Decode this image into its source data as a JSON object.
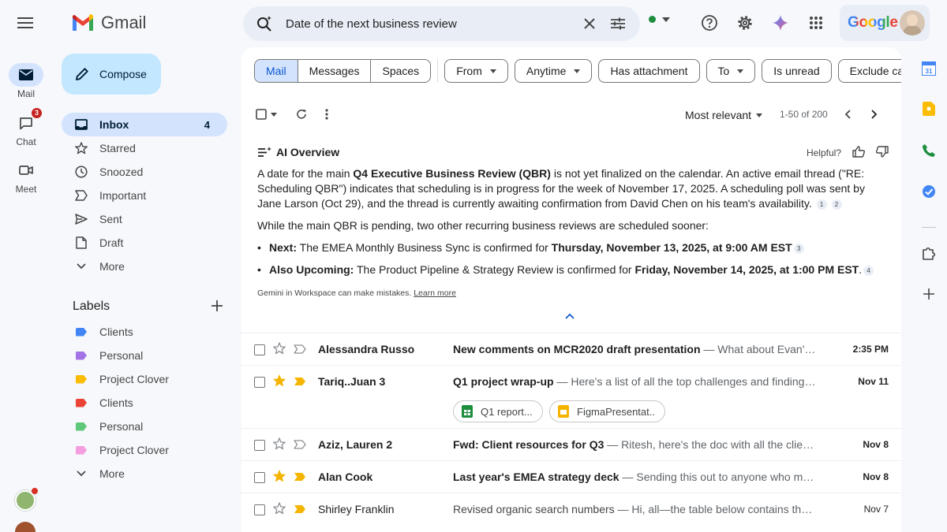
{
  "app": {
    "name": "Gmail"
  },
  "rail": {
    "items": [
      {
        "label": "Mail",
        "icon": "mail-icon",
        "active": true
      },
      {
        "label": "Chat",
        "icon": "chat-icon",
        "badge": "3"
      },
      {
        "label": "Meet",
        "icon": "video-icon"
      }
    ]
  },
  "header": {
    "search_value": "Date of the next business review",
    "brand_word": "Google"
  },
  "compose_label": "Compose",
  "nav": [
    {
      "label": "Inbox",
      "count": "4",
      "icon": "inbox-icon"
    },
    {
      "label": "Starred",
      "icon": "star-icon"
    },
    {
      "label": "Snoozed",
      "icon": "clock-icon"
    },
    {
      "label": "Important",
      "icon": "important-icon"
    },
    {
      "label": "Sent",
      "icon": "send-icon"
    },
    {
      "label": "Draft",
      "icon": "draft-icon"
    },
    {
      "label": "More",
      "icon": "chevron-down-icon"
    }
  ],
  "labels": {
    "title": "Labels",
    "items": [
      {
        "label": "Clients",
        "color": "#4285f4"
      },
      {
        "label": "Personal",
        "color": "#a374e6"
      },
      {
        "label": "Project Clover",
        "color": "#fbbc04"
      },
      {
        "label": "Clients",
        "color": "#ea4335"
      },
      {
        "label": "Personal",
        "color": "#5ec87a"
      },
      {
        "label": "Project Clover",
        "color": "#f49ee0"
      }
    ],
    "more": "More"
  },
  "filters": {
    "segments": [
      "Mail",
      "Messages",
      "Spaces"
    ],
    "chips": [
      {
        "label": "From",
        "dropdown": true
      },
      {
        "label": "Anytime",
        "dropdown": true
      },
      {
        "label": "Has attachment",
        "dropdown": false
      },
      {
        "label": "To",
        "dropdown": true
      },
      {
        "label": "Is unread",
        "dropdown": false
      },
      {
        "label": "Exclude cale",
        "dropdown": false
      }
    ]
  },
  "toolbar": {
    "sort": "Most relevant",
    "range": "1-50 of 200"
  },
  "ai_overview": {
    "title": "AI Overview",
    "helpful": "Helpful?",
    "p1_a": "A date for the main ",
    "p1_b": "Q4 Executive Business Review (QBR)",
    "p1_c": " is not yet finalized on the calendar. An active email thread (\"RE: Scheduling QBR\") indicates that scheduling is in progress for the week of November 17, 2025. A scheduling poll was sent by Jane Larson (Oct 29), and the thread is currently awaiting confirmation from David Chen on his team's availability.",
    "cite1": "1",
    "cite2": "2",
    "p2": "While the main QBR is pending, two other recurring business reviews are scheduled sooner:",
    "b1_label": "Next:",
    "b1_text": " The EMEA Monthly Business Sync is confirmed for ",
    "b1_bold": "Thursday, November 13, 2025, at 9:00 AM EST",
    "cite3": "3",
    "b2_label": "Also Upcoming:",
    "b2_text": " The Product Pipeline & Strategy Review is confirmed for ",
    "b2_bold": "Friday, November 14, 2025, at 1:00 PM EST",
    "b2_end": ".",
    "cite4": "4",
    "disclaimer": "Gemini in Workspace can make mistakes. ",
    "learn_more": "Learn more"
  },
  "emails": [
    {
      "sender": "Alessandra Russo",
      "subject": "New comments on MCR2020 draft presentation",
      "snippet": " — What about Evan's t...",
      "date": "2:35 PM",
      "starred": false,
      "important": false,
      "unread": true
    },
    {
      "sender": "Tariq..Juan 3",
      "subject": "Q1 project wrap-up",
      "snippet": " — Here's a list of all the top challenges and findings....",
      "date": "Nov 11",
      "starred": true,
      "important": true,
      "unread": true,
      "attachments": [
        {
          "name": "Q1 report...",
          "icon": "sheets-icon"
        },
        {
          "name": "FigmaPresentat..",
          "icon": "slides-icon"
        }
      ]
    },
    {
      "sender": "Aziz, Lauren 2",
      "subject": "Fwd: Client resources for Q3",
      "snippet": " — Ritesh, here's the doc with all the client r...",
      "date": "Nov 8",
      "starred": false,
      "important": false,
      "unread": true
    },
    {
      "sender": "Alan Cook",
      "subject": "Last year's EMEA strategy deck",
      "snippet": " — Sending this out to anyone who miss...",
      "date": "Nov 8",
      "starred": true,
      "important": true,
      "unread": true
    },
    {
      "sender": "Shirley Franklin",
      "subject": "Revised organic search numbers",
      "snippet": " — Hi, all—the table below contains the re...",
      "date": "Nov 7",
      "starred": false,
      "important": true,
      "unread": false
    }
  ],
  "colors": {
    "accent": "#0b57d0",
    "nav_active": "#d3e3fd",
    "compose": "#c2e7ff",
    "star": "#f4b400"
  }
}
